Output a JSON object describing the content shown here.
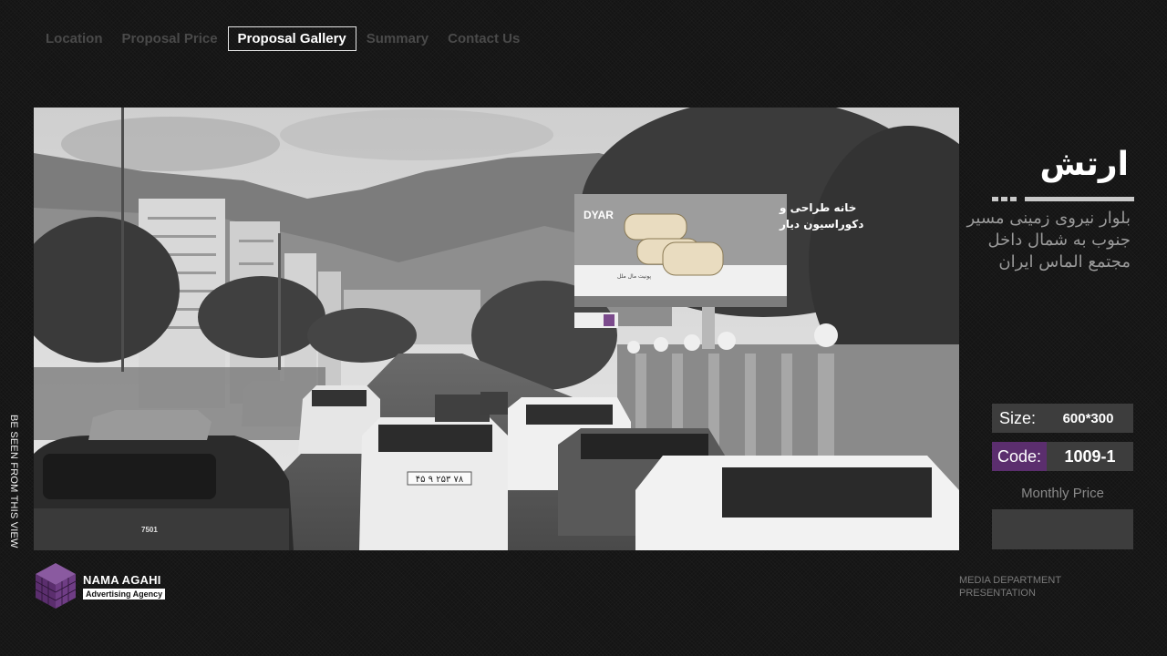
{
  "nav": {
    "items": [
      {
        "label": "Location",
        "active": false
      },
      {
        "label": "Proposal Price",
        "active": false
      },
      {
        "label": "Proposal Gallery",
        "active": true
      },
      {
        "label": "Summary",
        "active": false
      },
      {
        "label": "Contact Us",
        "active": false
      }
    ]
  },
  "photo": {
    "billboard_brand": "DYAR",
    "billboard_headline_line1": "خانه طراحی و",
    "billboard_headline_line2": "دکوراسیون دیار",
    "billboard_subline": "پونیت مال ملل",
    "plate_1": "۴۵ ۹ ۲۵۳ ۷۸",
    "plate_2": "7501"
  },
  "side_caption": "BE SEEN FROM THIS VIEW",
  "location": {
    "title": "ارتش",
    "address": "بلوار نیروی زمینی مسیر جنوب به شمال داخل مجتمع الماس ایران"
  },
  "specs": {
    "size_label": "Size:",
    "size_value": "600*300",
    "code_label": "Code:",
    "code_value": "1009-1",
    "monthly_price_label": "Monthly Price",
    "monthly_price_value": ""
  },
  "brand": {
    "name": "NAMA AGAHI",
    "tagline": "Advertising Agency"
  },
  "footer": {
    "line1": "MEDIA DEPARTMENT",
    "line2": "PRESENTATION"
  },
  "colors": {
    "background": "#141414",
    "accent_purple": "#5b2e6e",
    "box_gray": "#3d3d3d"
  }
}
